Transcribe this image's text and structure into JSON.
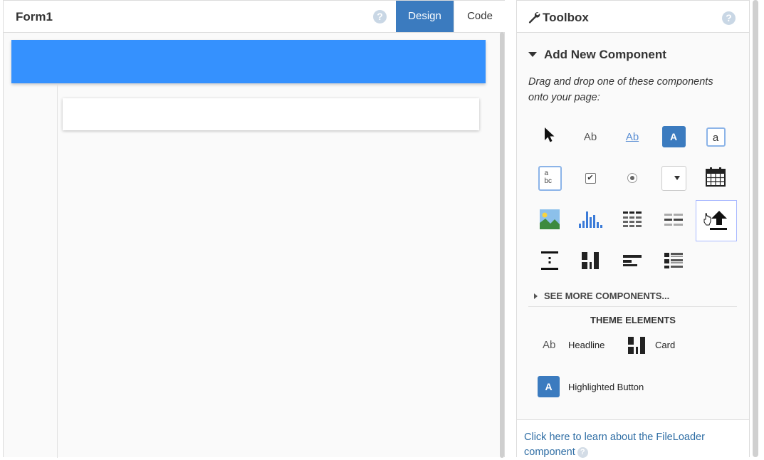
{
  "form": {
    "title": "Form1",
    "help": "?",
    "tabs": {
      "design": "Design",
      "code": "Code"
    },
    "active_tab": "Design",
    "header_color": "#3591fe"
  },
  "toolbox": {
    "title": "Toolbox",
    "help": "?",
    "section_title": "Add New Component",
    "description": "Drag and drop one of these components onto your page:",
    "components": [
      {
        "name": "pointer-icon"
      },
      {
        "name": "label-icon",
        "text": "Ab"
      },
      {
        "name": "link-icon",
        "text": "Ab"
      },
      {
        "name": "button-icon",
        "text": "A"
      },
      {
        "name": "textbox-icon",
        "text": "a"
      },
      {
        "name": "textarea-icon",
        "text": "a bc"
      },
      {
        "name": "checkbox-icon"
      },
      {
        "name": "radio-button-icon"
      },
      {
        "name": "dropdown-icon"
      },
      {
        "name": "date-picker-icon"
      },
      {
        "name": "image-icon"
      },
      {
        "name": "plot-icon"
      },
      {
        "name": "data-grid-icon"
      },
      {
        "name": "repeating-panel-icon"
      },
      {
        "name": "file-loader-icon",
        "selected": true
      },
      {
        "name": "spacer-icon"
      },
      {
        "name": "column-panel-icon"
      },
      {
        "name": "flow-panel-icon"
      },
      {
        "name": "linear-panel-icon"
      }
    ],
    "see_more": "SEE MORE COMPONENTS...",
    "theme_title": "THEME ELEMENTS",
    "theme_elements": [
      {
        "icon": "headline-icon",
        "icon_text": "Ab",
        "label": "Headline"
      },
      {
        "icon": "card-icon",
        "label": "Card"
      },
      {
        "icon": "highlighted-button-icon",
        "icon_text": "A",
        "label": "Highlighted Button"
      }
    ],
    "footer_link": "Click here to learn about the FileLoader component",
    "footer_help": "?"
  },
  "colors": {
    "accent": "#3b7bbf",
    "link": "#2e6da4",
    "selection_border": "#a8b8ff"
  }
}
